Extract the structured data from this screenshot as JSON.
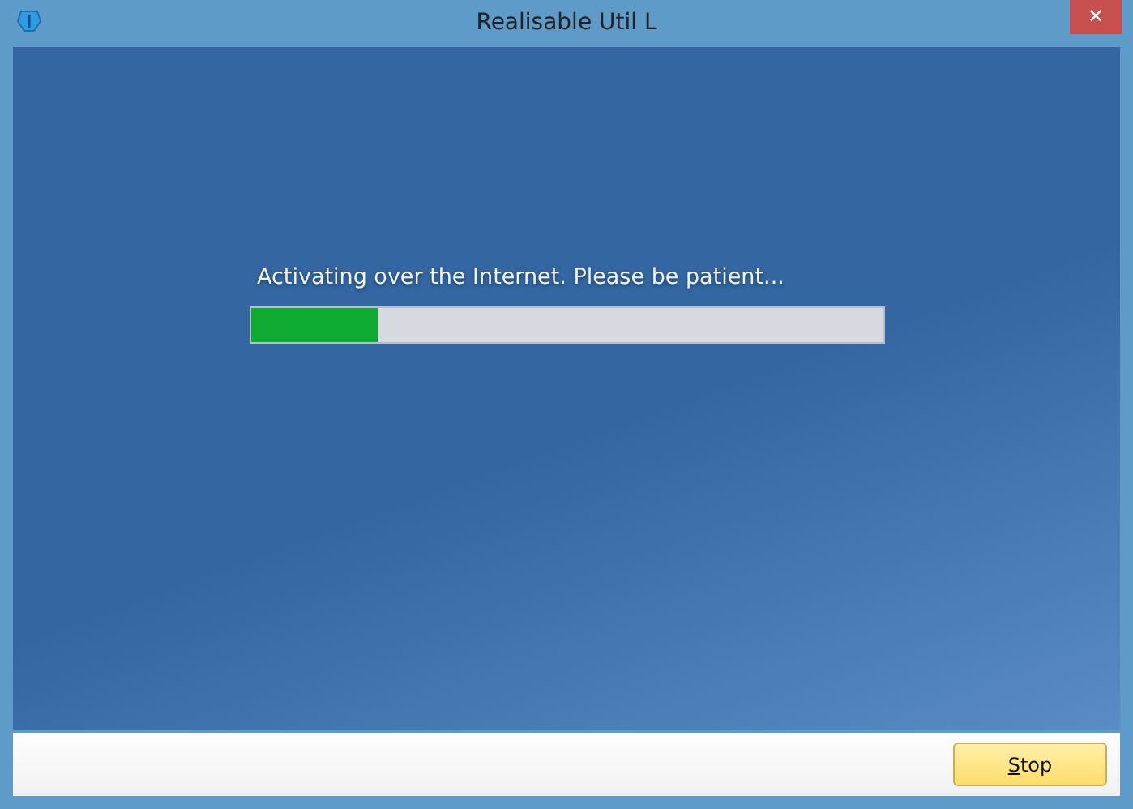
{
  "window": {
    "title": "Realisable Util L",
    "close": "✕"
  },
  "status": {
    "message": "Activating over the Internet. Please be patient...",
    "level": 0.2
  },
  "buttons": [
    {
      "label": "Stop",
      "mnemonic_underlined": true
    }
  ]
}
